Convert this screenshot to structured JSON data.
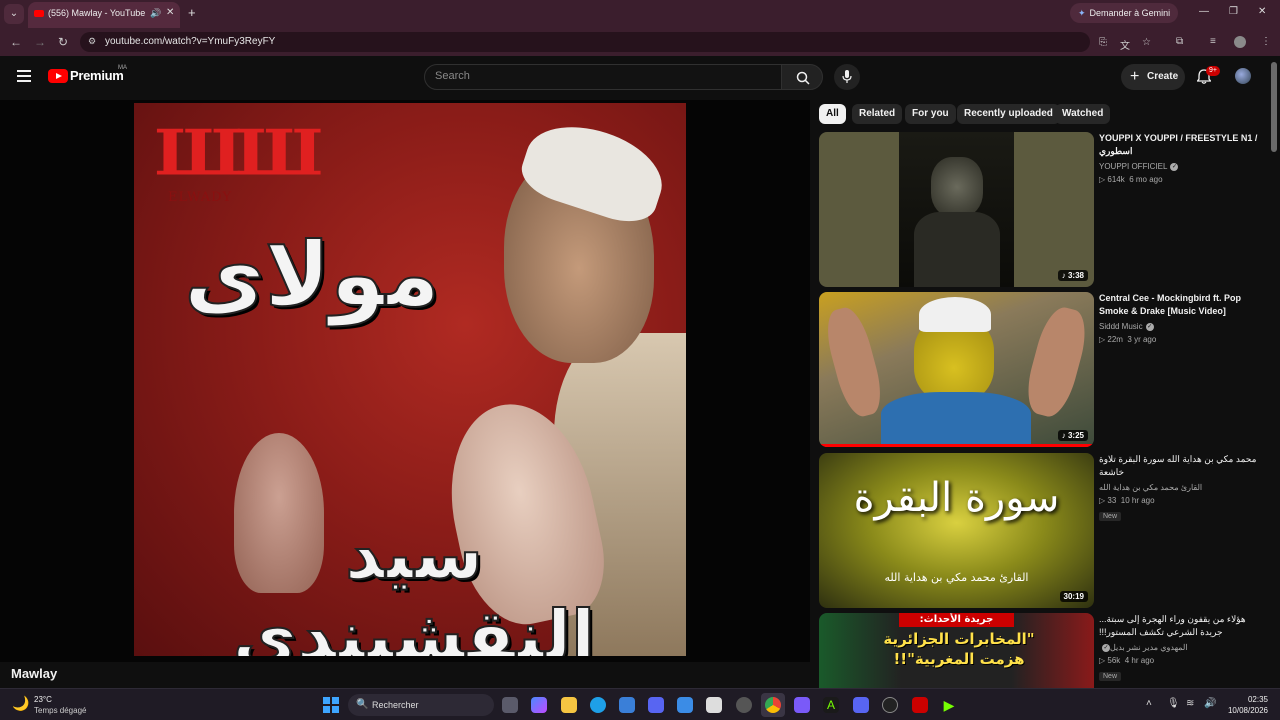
{
  "browser": {
    "tab_title": "(556) Mawlay - YouTube",
    "url": "youtube.com/watch?v=YmuFy3ReyFY",
    "gemini_label": "Demander à Gemini"
  },
  "youtube": {
    "brand": "Premium",
    "country": "MA",
    "search_placeholder": "Search",
    "create_label": "Create",
    "notification_count": "9+",
    "chips": [
      "All",
      "Related",
      "For you",
      "Recently uploaded",
      "Watched"
    ],
    "active_chip": "All"
  },
  "video": {
    "title": "Mawlay",
    "artwork": {
      "brand_mark": "ELWADY",
      "line1": "مولاى",
      "line2": "سيد النقشبندى"
    }
  },
  "recommendations": [
    {
      "title": "YOUPPI X YOUPPI / FREESTYLE N1 / اسطوري",
      "channel": "YOUPPI OFFICIEL",
      "verified": true,
      "views": "614k",
      "age": "6 mo ago",
      "duration": "3:38",
      "new": false
    },
    {
      "title": "Central Cee - Mockingbird ft. Pop Smoke & Drake [Music Video]",
      "channel": "Siddd Music",
      "verified": true,
      "views": "22m",
      "age": "3 yr ago",
      "duration": "3:25",
      "new": false
    },
    {
      "title": "محمد مكي بن هداية الله سورة البقرة تلاوة خاشعة",
      "channel": "القارئ محمد مكي بن هداية الله",
      "verified": false,
      "views": "33",
      "age": "10 hr ago",
      "duration": "30:19",
      "new": true,
      "new_label": "New",
      "thumb_text": "سورة البقرة",
      "thumb_subtext": "القارئ محمد مكي بن هداية الله"
    },
    {
      "title": "هؤلاء من يقفون وراء الهجرة إلى سبتة... جريدة الشرعي تكشف المستور!!!",
      "channel": "المهدوي مدير نشر بديل",
      "verified": true,
      "views": "56k",
      "age": "4 hr ago",
      "duration": "",
      "new": true,
      "new_label": "New",
      "thumb_text": "\"المخابرات الجزائرية هزمت المغربية\"!!",
      "thumb_banner": "جريدة الأحداث:"
    }
  ],
  "taskbar": {
    "temperature": "23°C",
    "weather": "Temps dégagé",
    "search_label": "Rechercher",
    "time": "02:35",
    "date": "10/08/2026"
  },
  "colors": {
    "yt_red": "#ff0000",
    "bg": "#0f0f0f",
    "chrome": "#3b1e2d"
  }
}
